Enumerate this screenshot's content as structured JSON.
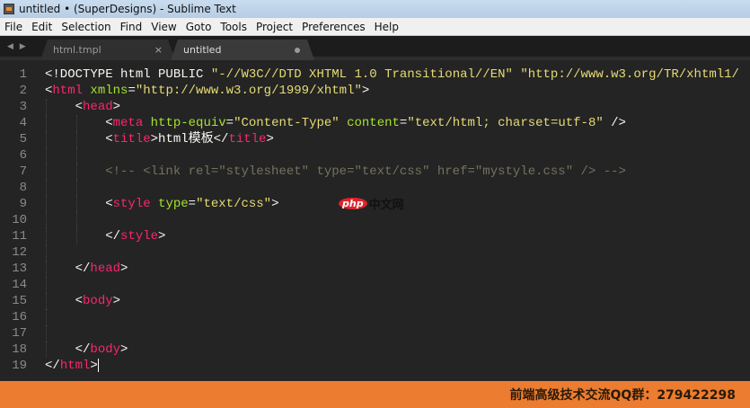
{
  "window": {
    "title": "untitled • (SuperDesigns) - Sublime Text"
  },
  "menu": [
    "File",
    "Edit",
    "Selection",
    "Find",
    "View",
    "Goto",
    "Tools",
    "Project",
    "Preferences",
    "Help"
  ],
  "tabs": [
    {
      "label": "html.tmpl",
      "close": "×"
    },
    {
      "label": "untitled"
    }
  ],
  "nav_arrows": "◀ ▶",
  "code": [
    [
      [
        "txt",
        "<!DOCTYPE html PUBLIC "
      ],
      [
        "str",
        "\"-//W3C//DTD XHTML 1.0 Transitional//EN\""
      ],
      [
        "txt",
        " "
      ],
      [
        "str",
        "\"http://www.w3.org/TR/xhtml1/"
      ]
    ],
    [
      [
        "txt",
        "<"
      ],
      [
        "tag",
        "html"
      ],
      [
        "txt",
        " "
      ],
      [
        "attr",
        "xmlns"
      ],
      [
        "txt",
        "="
      ],
      [
        "str",
        "\"http://www.w3.org/1999/xhtml\""
      ],
      [
        "txt",
        ">"
      ]
    ],
    [
      [
        "txt",
        "    <"
      ],
      [
        "tag",
        "head"
      ],
      [
        "txt",
        ">"
      ]
    ],
    [
      [
        "txt",
        "        <"
      ],
      [
        "tag",
        "meta"
      ],
      [
        "txt",
        " "
      ],
      [
        "attr",
        "http-equiv"
      ],
      [
        "txt",
        "="
      ],
      [
        "str",
        "\"Content-Type\""
      ],
      [
        "txt",
        " "
      ],
      [
        "attr",
        "content"
      ],
      [
        "txt",
        "="
      ],
      [
        "str",
        "\"text/html; charset=utf-8\""
      ],
      [
        "txt",
        " />"
      ]
    ],
    [
      [
        "txt",
        "        <"
      ],
      [
        "tag",
        "title"
      ],
      [
        "txt",
        ">html模板</"
      ],
      [
        "tag",
        "title"
      ],
      [
        "txt",
        ">"
      ]
    ],
    [],
    [
      [
        "txt",
        "        "
      ],
      [
        "com",
        "<!-- <link rel=\"stylesheet\" type=\"text/css\" href=\"mystyle.css\" /> -->"
      ]
    ],
    [],
    [
      [
        "txt",
        "        <"
      ],
      [
        "tag",
        "style"
      ],
      [
        "txt",
        " "
      ],
      [
        "attr",
        "type"
      ],
      [
        "txt",
        "="
      ],
      [
        "str",
        "\"text/css\""
      ],
      [
        "txt",
        ">"
      ]
    ],
    [],
    [
      [
        "txt",
        "        </"
      ],
      [
        "tag",
        "style"
      ],
      [
        "txt",
        ">"
      ]
    ],
    [],
    [
      [
        "txt",
        "    </"
      ],
      [
        "tag",
        "head"
      ],
      [
        "txt",
        ">"
      ]
    ],
    [],
    [
      [
        "txt",
        "    <"
      ],
      [
        "tag",
        "body"
      ],
      [
        "txt",
        ">"
      ]
    ],
    [],
    [],
    [
      [
        "txt",
        "    </"
      ],
      [
        "tag",
        "body"
      ],
      [
        "txt",
        ">"
      ]
    ],
    [
      [
        "txt",
        "</"
      ],
      [
        "tag",
        "html"
      ],
      [
        "txt",
        ">"
      ]
    ]
  ],
  "watermark": {
    "php": "php",
    "cn": "中文网"
  },
  "footer": {
    "text": "前端高级技术交流QQ群：279422298"
  }
}
